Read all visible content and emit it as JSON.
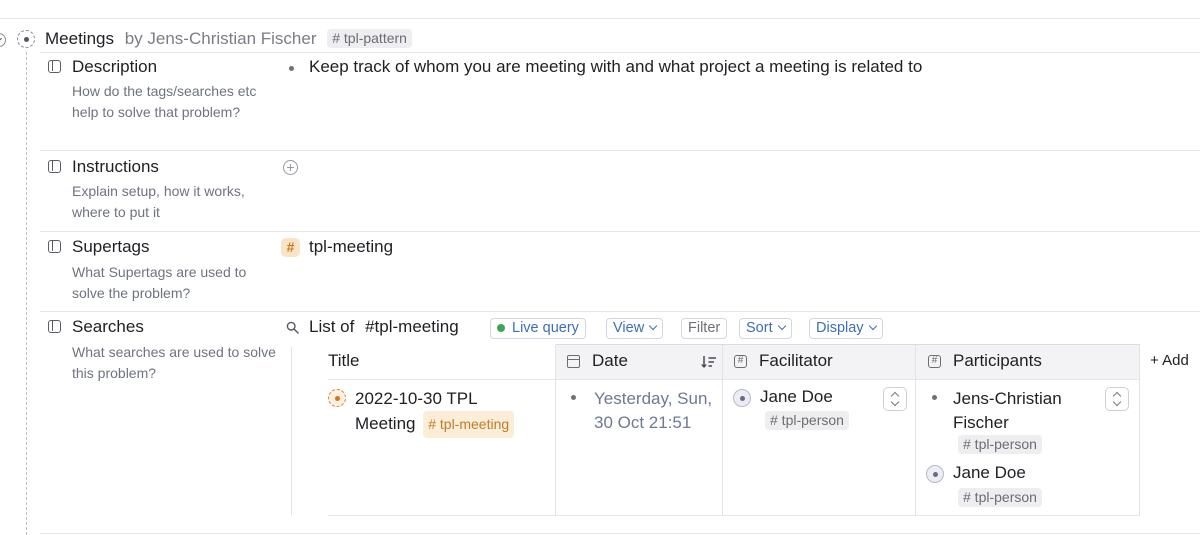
{
  "node": {
    "title": "Meetings",
    "author": "by Jens-Christian Fischer",
    "tag": "# tpl-pattern"
  },
  "fields": {
    "description": {
      "label": "Description",
      "help": "How do the tags/searches etc help to solve that problem?",
      "value": "Keep track of whom you are meeting with and what project a meeting is related to"
    },
    "instructions": {
      "label": "Instructions",
      "help": "Explain setup, how it works, where to put it"
    },
    "supertags": {
      "label": "Supertags",
      "help": "What Supertags are used to solve the problem?",
      "hash": "#",
      "value": "tpl-meeting"
    },
    "searches": {
      "label": "Searches",
      "help": "What searches are used to solve this problem?"
    }
  },
  "query": {
    "prefix": "List of",
    "tag": "#tpl-meeting",
    "live_label": "Live query",
    "view_label": "View",
    "filter_label": "Filter",
    "sort_label": "Sort",
    "display_label": "Display"
  },
  "table": {
    "columns": {
      "title": "Title",
      "date": "Date",
      "facilitator": "Facilitator",
      "participants": "Participants",
      "add": "+ Add"
    },
    "row": {
      "title_line1": "2022-10-30 TPL",
      "title_line2": "Meeting",
      "title_tag": "# tpl-meeting",
      "date_line1": "Yesterday, Sun,",
      "date_line2": "30 Oct 21:51",
      "facilitator": {
        "name": "Jane Doe",
        "tag": "# tpl-person"
      },
      "participants": [
        {
          "name_line1": "Jens-Christian",
          "name_line2": "Fischer",
          "tag": "# tpl-person"
        },
        {
          "name_line1": "Jane Doe",
          "tag": "# tpl-person"
        }
      ]
    }
  },
  "colors": {
    "accent_blue": "#3b6fb8",
    "tag_orange": "#c27a28",
    "live_green": "#3aa655"
  }
}
